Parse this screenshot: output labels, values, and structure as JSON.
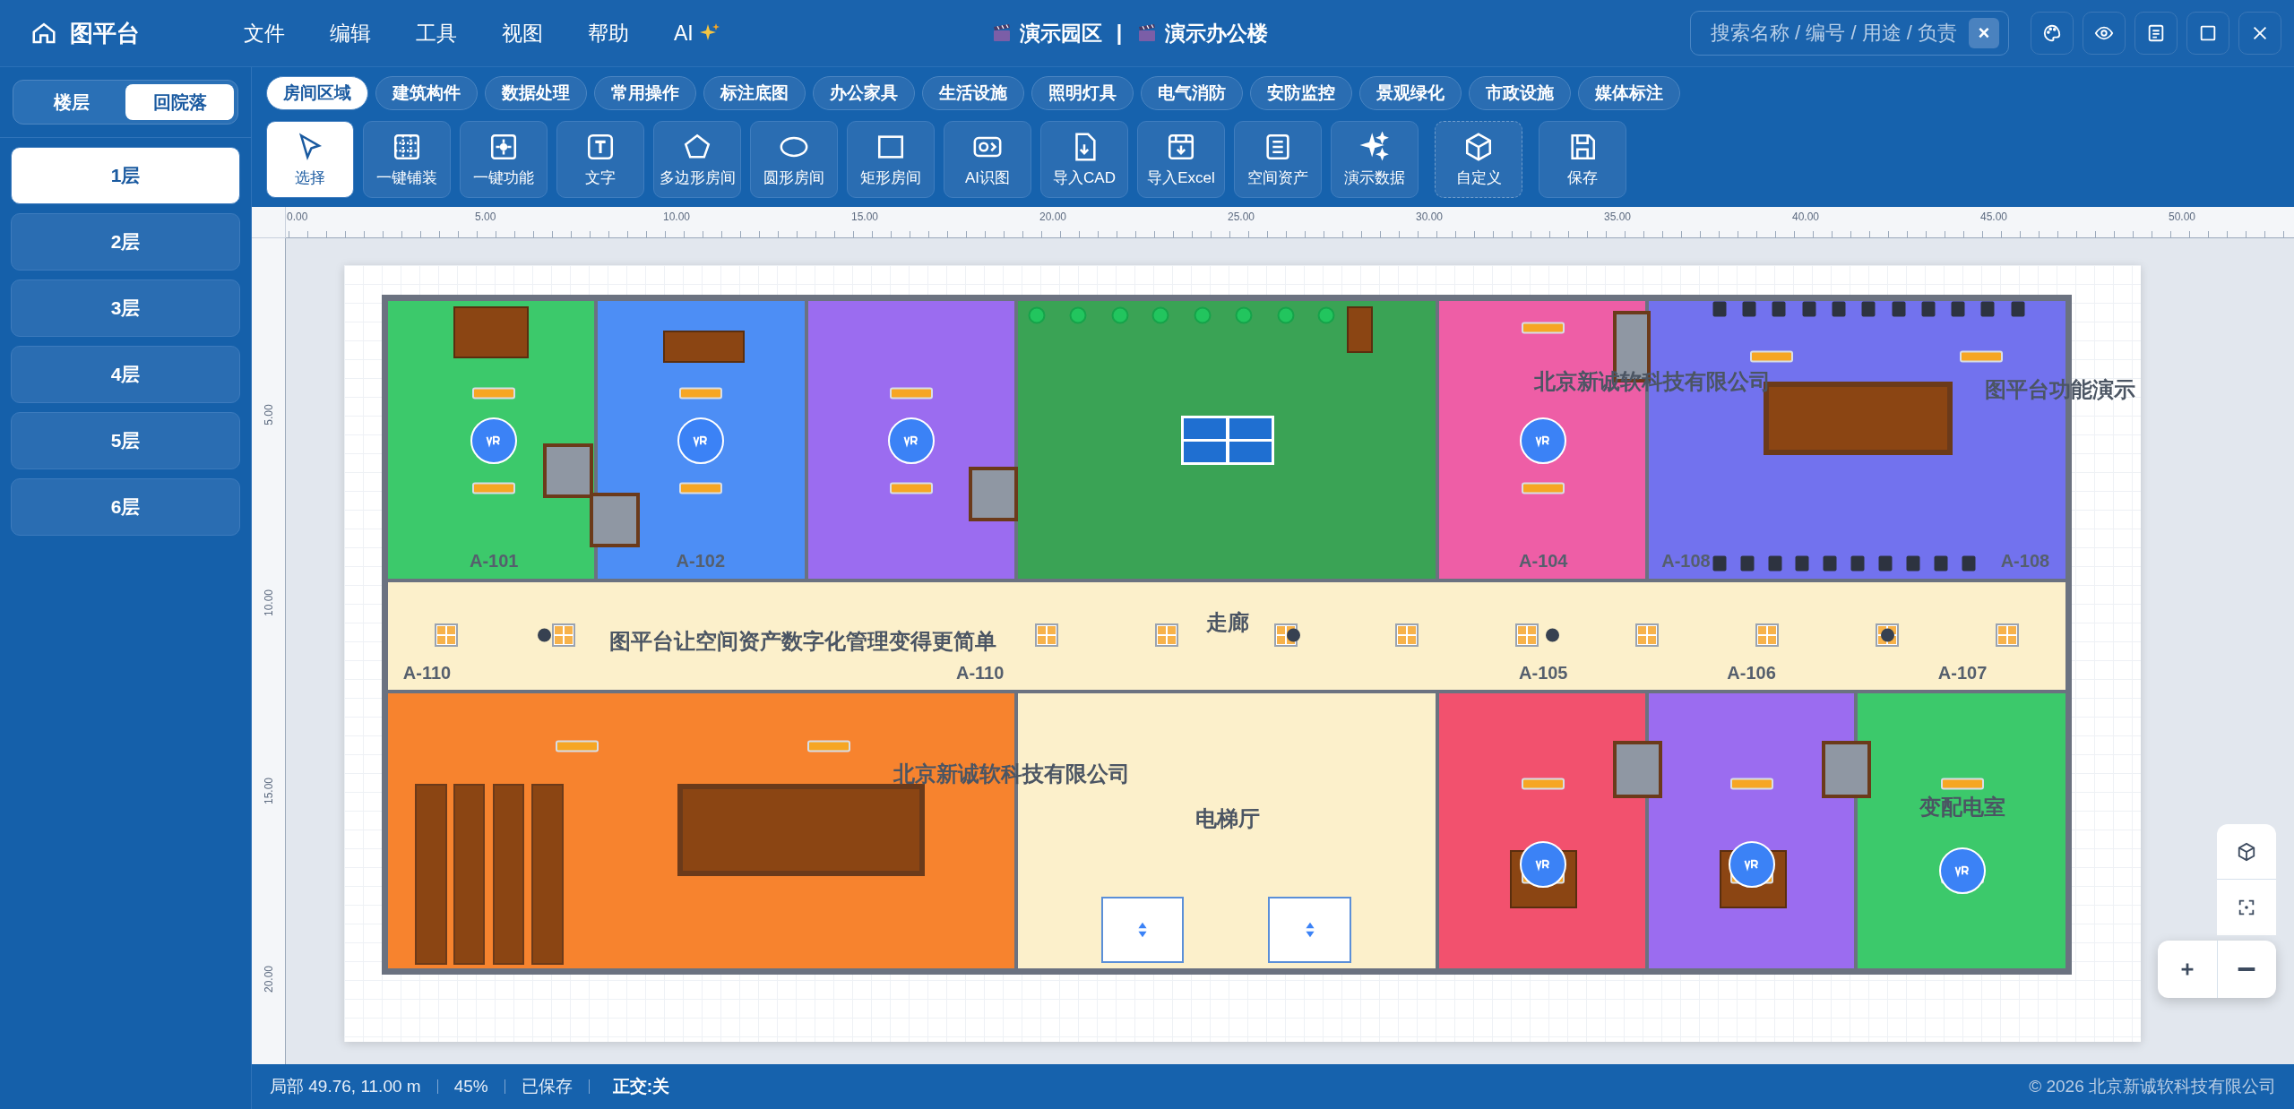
{
  "app": {
    "title": "图平台"
  },
  "menu": [
    {
      "label": "文件",
      "kind": "plain"
    },
    {
      "label": "编辑",
      "kind": "plain"
    },
    {
      "label": "工具",
      "kind": "plain"
    },
    {
      "label": "视图",
      "kind": "plain"
    },
    {
      "label": "帮助",
      "kind": "plain"
    },
    {
      "label": "AI",
      "kind": "ai"
    }
  ],
  "breadcrumb": {
    "items": [
      "演示园区",
      "演示办公楼"
    ],
    "separator": "|"
  },
  "search": {
    "placeholder": "搜索名称 / 编号 / 用途 / 负责",
    "clear": "×"
  },
  "sidebar": {
    "modes": [
      {
        "label": "楼层",
        "selected": false
      },
      {
        "label": "回院落",
        "selected": true
      }
    ],
    "floors": [
      {
        "label": "1层",
        "selected": true
      },
      {
        "label": "2层",
        "selected": false
      },
      {
        "label": "3层",
        "selected": false
      },
      {
        "label": "4层",
        "selected": false
      },
      {
        "label": "5层",
        "selected": false
      },
      {
        "label": "6层",
        "selected": false
      }
    ]
  },
  "categories": [
    {
      "label": "房间区域",
      "selected": true
    },
    {
      "label": "建筑构件",
      "selected": false
    },
    {
      "label": "数据处理",
      "selected": false
    },
    {
      "label": "常用操作",
      "selected": false
    },
    {
      "label": "标注底图",
      "selected": false
    },
    {
      "label": "办公家具",
      "selected": false
    },
    {
      "label": "生活设施",
      "selected": false
    },
    {
      "label": "照明灯具",
      "selected": false
    },
    {
      "label": "电气消防",
      "selected": false
    },
    {
      "label": "安防监控",
      "selected": false
    },
    {
      "label": "景观绿化",
      "selected": false
    },
    {
      "label": "市政设施",
      "selected": false
    },
    {
      "label": "媒体标注",
      "selected": false
    }
  ],
  "tools": [
    {
      "label": "选择",
      "kind": "select",
      "selected": true
    },
    {
      "label": "一键铺装",
      "kind": "tile",
      "selected": false
    },
    {
      "label": "一键功能",
      "kind": "function",
      "selected": false
    },
    {
      "label": "文字",
      "kind": "text",
      "selected": false
    },
    {
      "label": "多边形房间",
      "kind": "polygon",
      "selected": false
    },
    {
      "label": "圆形房间",
      "kind": "circle",
      "selected": false
    },
    {
      "label": "矩形房间",
      "kind": "rect",
      "selected": false
    },
    {
      "label": "AI识图",
      "kind": "ai",
      "selected": false
    },
    {
      "label": "导入CAD",
      "kind": "cad",
      "selected": false
    },
    {
      "label": "导入Excel",
      "kind": "excel",
      "selected": false
    },
    {
      "label": "空间资产",
      "kind": "asset",
      "selected": false
    },
    {
      "label": "演示数据",
      "kind": "demo",
      "selected": false
    },
    {
      "label": "自定义",
      "kind": "custom",
      "selected": false
    },
    {
      "label": "保存",
      "kind": "save",
      "selected": false
    }
  ],
  "ruler": {
    "x_ticks": [
      "0.00",
      "5.00",
      "10.00",
      "15.00",
      "20.00",
      "25.00",
      "30.00",
      "35.00",
      "40.00",
      "45.00",
      "50.00"
    ],
    "y_ticks": [
      "5.00",
      "10.00",
      "15.00",
      "20.00"
    ]
  },
  "plan": {
    "rooms": [
      {
        "color": "#3cc96b"
      },
      {
        "color": "#4d8ef5"
      },
      {
        "color": "#9b6cf0"
      },
      {
        "color": "#3aa355"
      },
      {
        "color": "#ee5ea6"
      },
      {
        "color": "#7272ee"
      },
      {
        "color": "#fcf0cb"
      },
      {
        "color": "#f7832e"
      },
      {
        "color": "#fcf0cb"
      },
      {
        "color": "#f2516e"
      },
      {
        "color": "#9b6cf0"
      },
      {
        "color": "#3cc96b"
      }
    ],
    "labels": [
      "A-101",
      "A-102",
      "A-104",
      "A-108",
      "A-108",
      "走廊",
      "图平台让空间资产数字化管理变得更简单",
      "A-110",
      "A-110",
      "A-105",
      "A-106",
      "A-107",
      "北京新诚软科技有限公司",
      "电梯厅",
      "北京新诚软科技有限公司",
      "图平台功能演示",
      "变配电室"
    ]
  },
  "status": {
    "cursor": "局部 49.76, 11.00 m",
    "zoom": "45%",
    "saved": "已保存",
    "ortho": "正交:关",
    "copyright": "© 2026 北京新诚软科技有限公司"
  }
}
